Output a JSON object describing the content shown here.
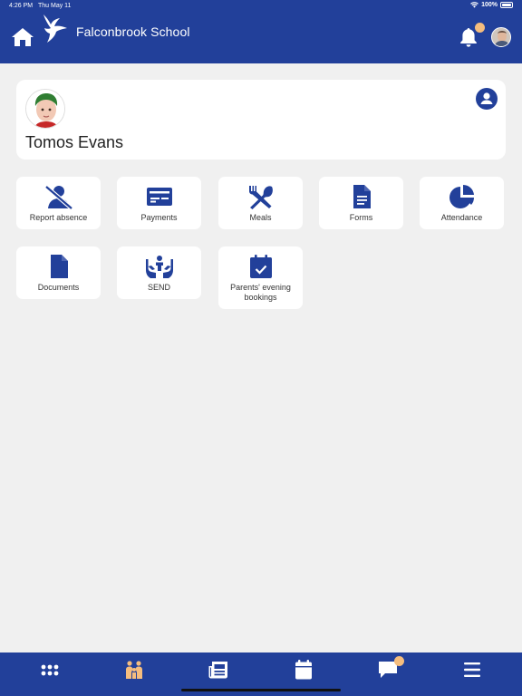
{
  "status_bar": {
    "time": "4:26 PM",
    "date": "Thu May 11",
    "battery": "100%"
  },
  "header": {
    "school_name": "Falconbrook School"
  },
  "pupil": {
    "name": "Tomos Evans"
  },
  "tiles": [
    {
      "label": "Report absence",
      "icon": "person-off-icon"
    },
    {
      "label": "Payments",
      "icon": "credit-card-icon"
    },
    {
      "label": "Meals",
      "icon": "fork-knife-icon"
    },
    {
      "label": "Forms",
      "icon": "document-icon"
    },
    {
      "label": "Attendance",
      "icon": "pie-chart-icon"
    },
    {
      "label": "Documents",
      "icon": "file-icon"
    },
    {
      "label": "SEND",
      "icon": "hands-person-icon"
    },
    {
      "label": "Parents' evening bookings",
      "icon": "calendar-check-icon"
    }
  ],
  "colors": {
    "primary": "#22409a",
    "background": "#f0f0f0",
    "notification": "#f5bd7e",
    "active_nav": "#f5bd7e"
  },
  "bottom_nav": [
    "grid-icon",
    "family-icon",
    "newspaper-icon",
    "calendar-icon",
    "chat-icon",
    "menu-icon"
  ]
}
